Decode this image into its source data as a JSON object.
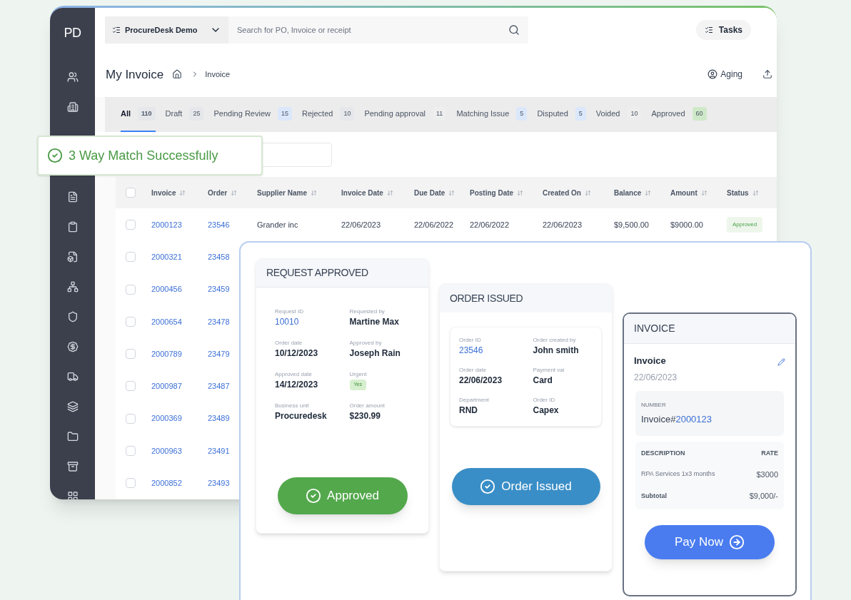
{
  "app": {
    "logo": "PD",
    "workspace": "ProcureDesk Demo",
    "search": {
      "placeholder": "Search for PO, Invoice or receipt"
    },
    "tasks": "Tasks"
  },
  "page": {
    "title": "My Invoice",
    "breadcrumb": "Invoice",
    "aging": "Aging"
  },
  "tabs": [
    {
      "label": "All",
      "count": "110",
      "selected": true,
      "color": "#e5e7eb"
    },
    {
      "label": "Draft",
      "count": "25",
      "selected": false,
      "color": "#e5e7eb"
    },
    {
      "label": "Pending Review",
      "count": "15",
      "selected": false,
      "color": "#dbe7fb"
    },
    {
      "label": "Rejected",
      "count": "10",
      "selected": false,
      "color": "#e5e7eb"
    },
    {
      "label": "Pending approval",
      "count": "11",
      "selected": false,
      "color": "#eeeeee"
    },
    {
      "label": "Matching Issue",
      "count": "5",
      "selected": false,
      "color": "#dbe7fb"
    },
    {
      "label": "Disputed",
      "count": "5",
      "selected": false,
      "color": "#dbe7fb"
    },
    {
      "label": "Voided",
      "count": "10",
      "selected": false,
      "color": "#eeeeee"
    },
    {
      "label": "Approved",
      "count": "60",
      "selected": false,
      "color": "#cfe9c8"
    }
  ],
  "toast": {
    "text": "3 Way Match Successfully"
  },
  "table": {
    "header_checked": false,
    "columns": [
      "Invoice",
      "Order",
      "Supplier Name",
      "Invoice Date",
      "Due Date",
      "Posting Date",
      "Created On",
      "Balance",
      "Amount",
      "Status"
    ],
    "rows": [
      {
        "checked": false,
        "cells": [
          "2000123",
          "23546",
          "Grander inc",
          "22/06/2023",
          "22/06/2022",
          "22/06/2022",
          "22/06/2023",
          "$9,500.00",
          "$9000.00",
          "Approved"
        ]
      },
      {
        "checked": false,
        "cells": [
          "2000321",
          "23458"
        ]
      },
      {
        "checked": false,
        "cells": [
          "2000456",
          "23459"
        ]
      },
      {
        "checked": false,
        "cells": [
          "2000654",
          "23478"
        ]
      },
      {
        "checked": false,
        "cells": [
          "2000789",
          "23479"
        ]
      },
      {
        "checked": false,
        "cells": [
          "2000987",
          "23487"
        ]
      },
      {
        "checked": false,
        "cells": [
          "2000369",
          "23489"
        ]
      },
      {
        "checked": false,
        "cells": [
          "2000963",
          "23491"
        ]
      },
      {
        "checked": false,
        "cells": [
          "2000852",
          "23493"
        ]
      }
    ]
  },
  "request_card": {
    "title": "REQUEST APPROVED",
    "fields": [
      {
        "label": "Request ID",
        "value": "10010",
        "kind": "link"
      },
      {
        "label": "Requested by",
        "value": "Martine Max",
        "kind": "text"
      },
      {
        "label": "Order date",
        "value": "10/12/2023",
        "kind": "text"
      },
      {
        "label": "Approved by",
        "value": "Joseph Rain",
        "kind": "text"
      },
      {
        "label": "Approved date",
        "value": "14/12/2023",
        "kind": "text"
      },
      {
        "label": "Urgent",
        "value": "Yes",
        "kind": "tag"
      },
      {
        "label": "Business unit",
        "value": "Procuredesk",
        "kind": "text"
      },
      {
        "label": "Order amount",
        "value": "$230.99",
        "kind": "text"
      }
    ],
    "button": "Approved"
  },
  "order_card": {
    "title": "ORDER ISSUED",
    "fields": [
      {
        "label": "Order ID",
        "value": "23546",
        "kind": "link"
      },
      {
        "label": "Order created by",
        "value": "John smith",
        "kind": "text"
      },
      {
        "label": "Order date",
        "value": "22/06/2023",
        "kind": "text"
      },
      {
        "label": "Payment vai",
        "value": "Card",
        "kind": "text"
      },
      {
        "label": "Department",
        "value": "RND",
        "kind": "text"
      },
      {
        "label": "Order ID",
        "value": "Capex",
        "kind": "text"
      }
    ],
    "button": "Order Issued"
  },
  "invoice_card": {
    "title": "INVOICE",
    "name": "Invoice",
    "date": "22/06/2023",
    "number_label": "NUMBER",
    "number_prefix": "Invoice#",
    "number": "2000123",
    "columns": [
      "DESCRIPTION",
      "RATE"
    ],
    "line": {
      "description": "RPA Services 1x3 months",
      "rate": "$3000"
    },
    "subtotal_label": "Subtotal",
    "subtotal": "$9,000/-",
    "button": "Pay Now"
  }
}
